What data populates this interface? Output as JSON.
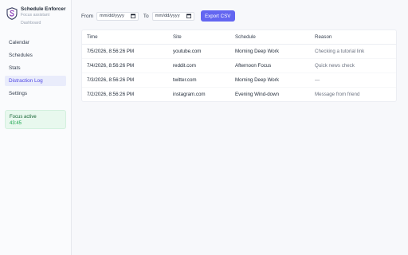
{
  "brand": {
    "name": "Schedule Enforcer",
    "subtitle": "Focus assistant",
    "page": "Dashboard"
  },
  "nav": {
    "items": [
      {
        "label": "Calendar"
      },
      {
        "label": "Schedules"
      },
      {
        "label": "Stats"
      },
      {
        "label": "Distraction Log",
        "active": true
      },
      {
        "label": "Settings"
      }
    ]
  },
  "focus": {
    "title": "Focus active",
    "time": "43:45"
  },
  "filters": {
    "from_label": "From",
    "to_label": "To",
    "from_value": "mm/dd/yyyy",
    "to_value": "mm/dd/yyyy",
    "export_label": "Export CSV"
  },
  "table": {
    "headers": {
      "time": "Time",
      "site": "Site",
      "schedule": "Schedule",
      "reason": "Reason"
    },
    "rows": [
      {
        "time": "7/5/2026, 8:56:26 PM",
        "site": "youtube.com",
        "schedule": "Morning Deep Work",
        "reason": "Checking a tutorial link"
      },
      {
        "time": "7/4/2026, 8:56:26 PM",
        "site": "reddit.com",
        "schedule": "Afternoon Focus",
        "reason": "Quick news check"
      },
      {
        "time": "7/3/2026, 8:56:26 PM",
        "site": "twitter.com",
        "schedule": "Morning Deep Work",
        "reason": "—"
      },
      {
        "time": "7/2/2026, 8:56:26 PM",
        "site": "instagram.com",
        "schedule": "Evening Wind-down",
        "reason": "Message from friend"
      }
    ]
  },
  "colors": {
    "accent": "#6366f1",
    "active_nav_bg": "#e9ecfb",
    "focus_bg": "#e8f8ee",
    "focus_text": "#16a34a"
  },
  "icons": {
    "brand": "shield-s-logo-icon",
    "date": "calendar-icon"
  }
}
